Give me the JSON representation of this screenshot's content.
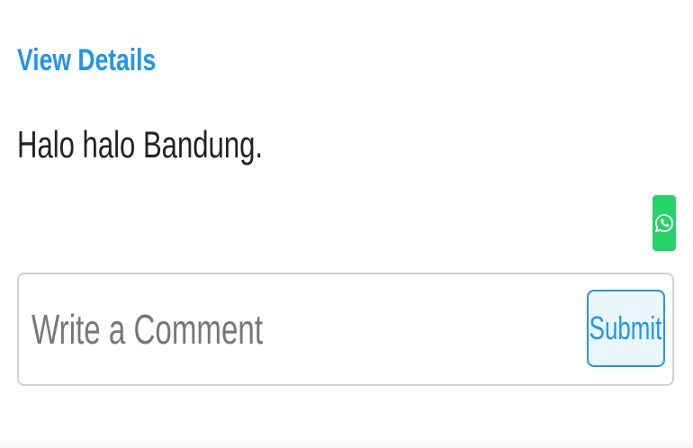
{
  "post": {
    "view_details_label": "View Details",
    "text": "Halo halo Bandung."
  },
  "share": {
    "icon": "whatsapp-icon",
    "color": "#25d366"
  },
  "comment": {
    "placeholder": "Write a Comment",
    "value": "",
    "submit_label": "Submit"
  },
  "colors": {
    "accent": "#2196e8",
    "text": "#222222",
    "border": "#d2d2d2"
  }
}
